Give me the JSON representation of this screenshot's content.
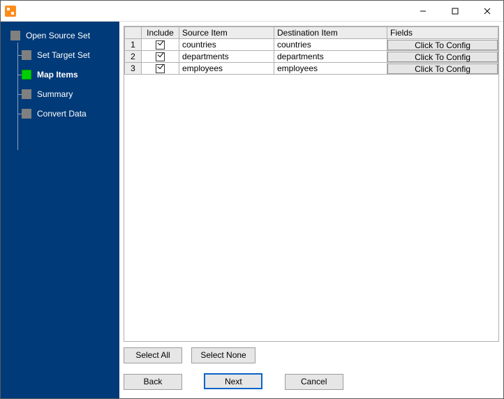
{
  "sidebar": {
    "items": [
      {
        "label": "Open Source Set",
        "level": "root",
        "active": false
      },
      {
        "label": "Set Target Set",
        "level": "child",
        "active": false
      },
      {
        "label": "Map Items",
        "level": "child",
        "active": true
      },
      {
        "label": "Summary",
        "level": "child",
        "active": false
      },
      {
        "label": "Convert Data",
        "level": "child",
        "active": false
      }
    ]
  },
  "grid": {
    "headers": {
      "include": "Include",
      "source": "Source Item",
      "dest": "Destination Item",
      "fields": "Fields"
    },
    "config_label": "Click To Config",
    "rows": [
      {
        "n": "1",
        "include": true,
        "source": "countries",
        "dest": "countries"
      },
      {
        "n": "2",
        "include": true,
        "source": "departments",
        "dest": "departments"
      },
      {
        "n": "3",
        "include": true,
        "source": "employees",
        "dest": "employees"
      }
    ]
  },
  "buttons": {
    "select_all": "Select All",
    "select_none": "Select None",
    "back": "Back",
    "next": "Next",
    "cancel": "Cancel"
  }
}
